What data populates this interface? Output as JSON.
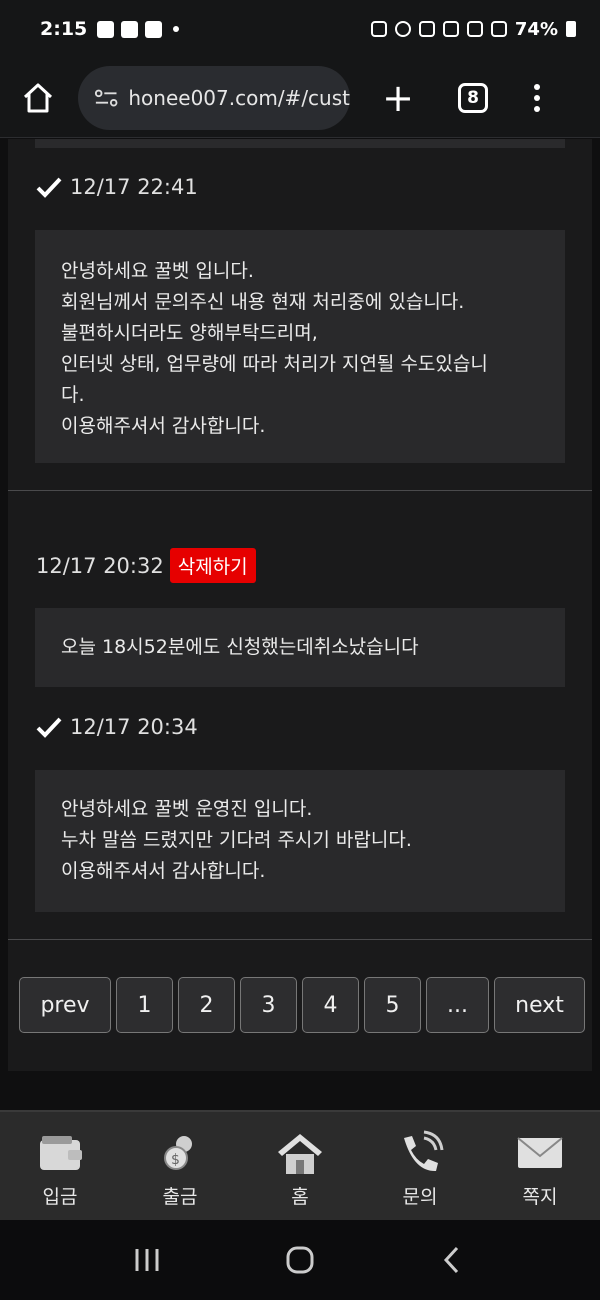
{
  "status": {
    "time": "2:15",
    "battery": "74%"
  },
  "browser": {
    "url": "honee007.com/#/cust",
    "tab_count": "8",
    "new_tab": "+"
  },
  "inquiries": [
    {
      "answer_time": "12/17 22:41",
      "answer_lines": [
        "안녕하세요 꿀벳 입니다.",
        "회원님께서 문의주신 내용 현재 처리중에 있습니다.",
        "불편하시더라도 양해부탁드리며,",
        "인터넷 상태, 업무량에 따라 처리가 지연될 수도있습니",
        "다.",
        "이용해주셔서 감사합니다."
      ]
    },
    {
      "question_time": "12/17 20:32",
      "delete_label": "삭제하기",
      "question_text": "오늘 18시52분에도 신청했는데취소났습니다",
      "answer_time": "12/17 20:34",
      "answer_lines": [
        "안녕하세요 꿀벳 운영진 입니다.",
        "누차 말씀 드렸지만 기다려 주시기 바랍니다.",
        "이용해주셔서 감사합니다."
      ]
    }
  ],
  "pagination": {
    "prev": "prev",
    "pages": [
      "1",
      "2",
      "3",
      "4",
      "5",
      "..."
    ],
    "next": "next"
  },
  "app_nav": [
    "입금",
    "출금",
    "홈",
    "문의",
    "쪽지"
  ],
  "colors": {
    "delete": "#e60000",
    "background": "#1a1a1b",
    "box": "#29292b"
  }
}
